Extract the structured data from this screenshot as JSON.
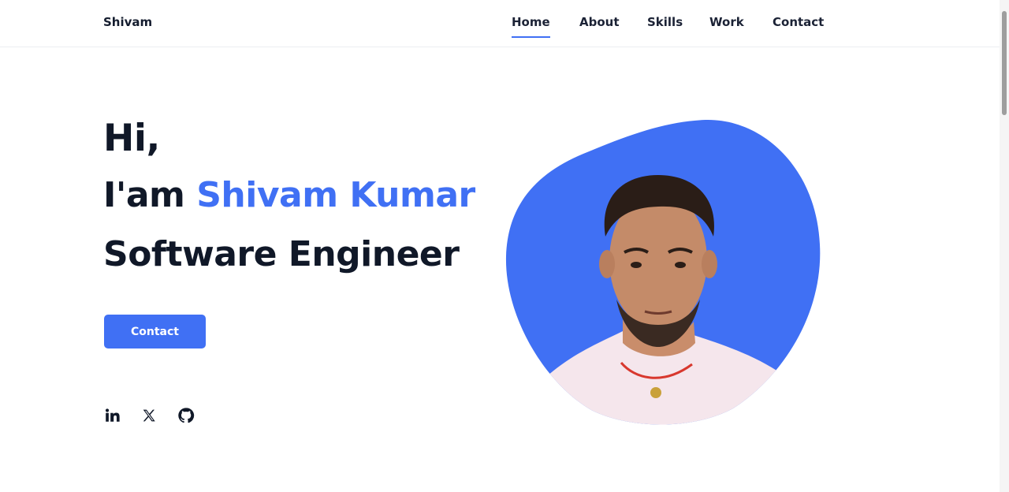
{
  "header": {
    "logo": "Shivam",
    "nav": [
      {
        "label": "Home",
        "active": true
      },
      {
        "label": "About",
        "active": false
      },
      {
        "label": "Skills",
        "active": false
      },
      {
        "label": "Work",
        "active": false
      },
      {
        "label": "Contact",
        "active": false
      }
    ]
  },
  "hero": {
    "greeting": "Hi,",
    "intro_prefix": "I'am",
    "name": "Shivam Kumar",
    "role": "Software Engineer",
    "contact_label": "Contact"
  },
  "social": [
    {
      "name": "linkedin-icon"
    },
    {
      "name": "x-icon"
    },
    {
      "name": "github-icon"
    }
  ],
  "colors": {
    "accent": "#4070f4",
    "heading": "#101828"
  }
}
